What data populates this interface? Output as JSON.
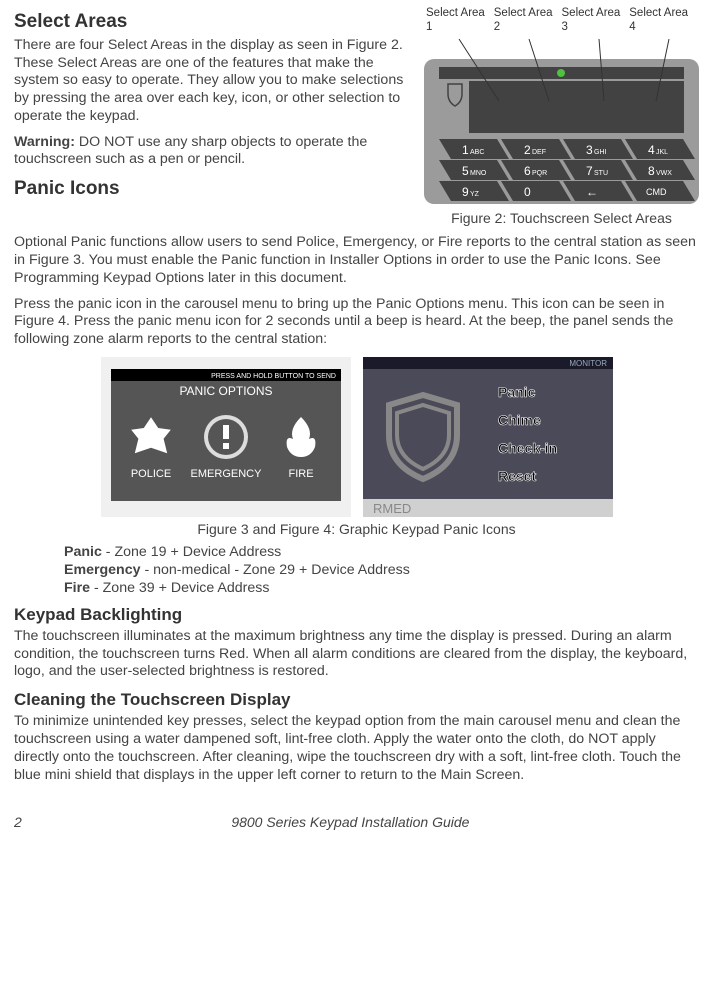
{
  "sections": {
    "selectAreas": {
      "heading": "Select Areas",
      "p1": "There are four Select Areas in the display as seen in Figure 2. These Select Areas are one of the features that make the system so easy to operate. They allow you to make selections by pressing the area over each key, icon, or other selection to operate the keypad.",
      "warnLabel": "Warning:",
      "warnText": " DO NOT use any sharp objects to operate the touchscreen such as a pen or pencil."
    },
    "panicIcons": {
      "heading": "Panic Icons",
      "p1": "Optional Panic functions allow users to send Police, Emergency, or Fire reports to the central station as seen in Figure 3. You must enable the Panic function in Installer Options in order to use the Panic Icons. See Programming Keypad Options later in this document.",
      "p2": "Press the panic icon in the carousel menu to bring up the Panic Options menu. This icon can be seen in Figure 4. Press the panic menu icon for 2 seconds until a beep is heard. At the beep, the panel sends the following zone alarm reports to the central station:"
    },
    "zoneList": {
      "panicLabel": "Panic",
      "panicText": " - Zone 19 + Device Address",
      "emergLabel": "Emergency",
      "emergText": " - non-medical - Zone 29 + Device Address",
      "fireLabel": "Fire",
      "fireText": " - Zone 39 + Device Address"
    },
    "backlight": {
      "heading": "Keypad Backlighting",
      "p1": "The touchscreen illuminates at the maximum brightness any time the display is pressed. During an alarm condition, the touchscreen turns Red. When all alarm conditions are cleared from the display, the keyboard, logo, and the user-selected brightness is restored."
    },
    "cleaning": {
      "heading": "Cleaning the Touchscreen Display",
      "p1": "To minimize unintended key presses, select the keypad option from the main carousel menu and clean the touchscreen using a water dampened soft, lint-free cloth. Apply the water onto the cloth, do NOT apply directly onto the touchscreen. After cleaning, wipe the touchscreen dry with a soft, lint-free cloth. Touch the blue mini shield that displays in the upper left corner to return to the Main Screen."
    }
  },
  "fig2": {
    "labels": [
      "Select Area 1",
      "Select Area 2",
      "Select Area 3",
      "Select Area 4"
    ],
    "caption": "Figure 2: Touchscreen Select Areas",
    "keys": {
      "r1": [
        {
          "n": "1",
          "s": "ABC"
        },
        {
          "n": "2",
          "s": "DEF"
        },
        {
          "n": "3",
          "s": "GHI"
        },
        {
          "n": "4",
          "s": "JKL"
        }
      ],
      "r2": [
        {
          "n": "5",
          "s": "MNO"
        },
        {
          "n": "6",
          "s": "PQR"
        },
        {
          "n": "7",
          "s": "STU"
        },
        {
          "n": "8",
          "s": "VWX"
        }
      ],
      "r3": [
        {
          "n": "9",
          "s": "YZ"
        },
        {
          "n": "0",
          "s": ""
        },
        {
          "n": "←",
          "s": ""
        },
        {
          "n": "",
          "s": "CMD"
        }
      ]
    }
  },
  "fig3": {
    "topbar": "PRESS  AND HOLD BUTTON TO SEND",
    "title": "PANIC OPTIONS",
    "buttons": [
      "POLICE",
      "EMERGENCY",
      "FIRE"
    ]
  },
  "fig4": {
    "topright": "MONITOR",
    "menu": [
      "Panic",
      "Chime",
      "Check-in",
      "Reset"
    ],
    "corner": "RMED"
  },
  "figs34Caption": "Figure 3 and Figure 4: Graphic Keypad Panic Icons",
  "footer": {
    "page": "2",
    "title": "9800 Series Keypad Installation Guide"
  }
}
